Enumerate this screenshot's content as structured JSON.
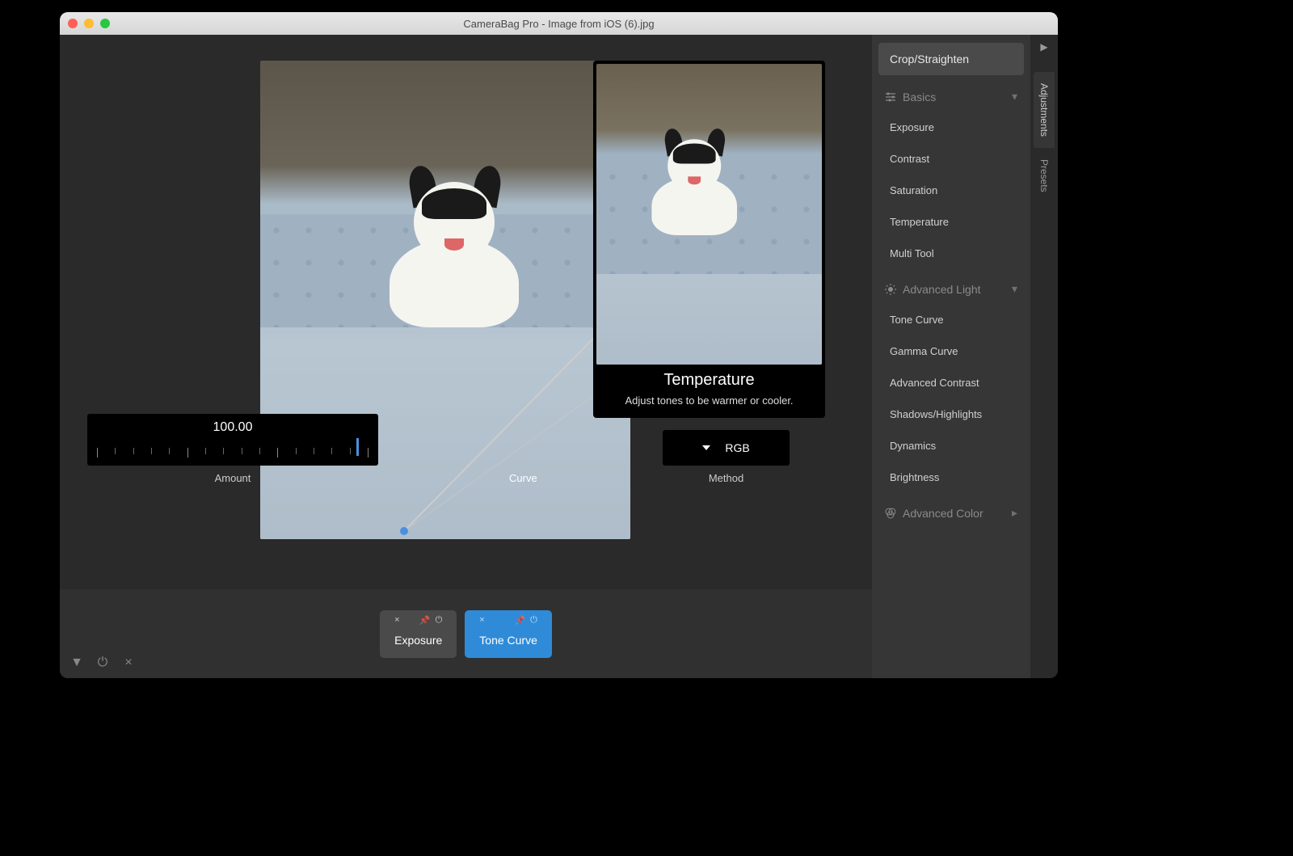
{
  "window": {
    "title": "CameraBag Pro - Image from iOS (6).jpg"
  },
  "tooltip": {
    "title": "Temperature",
    "description": "Adjust tones to be warmer or cooler."
  },
  "controls": {
    "amount": {
      "value": "100.00",
      "label": "Amount"
    },
    "curve": {
      "label": "Curve"
    },
    "method": {
      "value": "RGB",
      "label": "Method"
    }
  },
  "filter_chips": [
    {
      "label": "Exposure",
      "active": false
    },
    {
      "label": "Tone Curve",
      "active": true
    }
  ],
  "sidebar": {
    "crop_button": "Crop/Straighten",
    "groups": [
      {
        "name": "Basics",
        "icon": "sliders-icon",
        "items": [
          "Exposure",
          "Contrast",
          "Saturation",
          "Temperature",
          "Multi Tool"
        ]
      },
      {
        "name": "Advanced Light",
        "icon": "brightness-icon",
        "items": [
          "Tone Curve",
          "Gamma Curve",
          "Advanced Contrast",
          "Shadows/Highlights",
          "Dynamics",
          "Brightness"
        ]
      },
      {
        "name": "Advanced Color",
        "icon": "color-circles-icon",
        "items": []
      }
    ]
  },
  "vertical_tabs": [
    {
      "label": "Adjustments",
      "active": true
    },
    {
      "label": "Presets",
      "active": false
    }
  ]
}
